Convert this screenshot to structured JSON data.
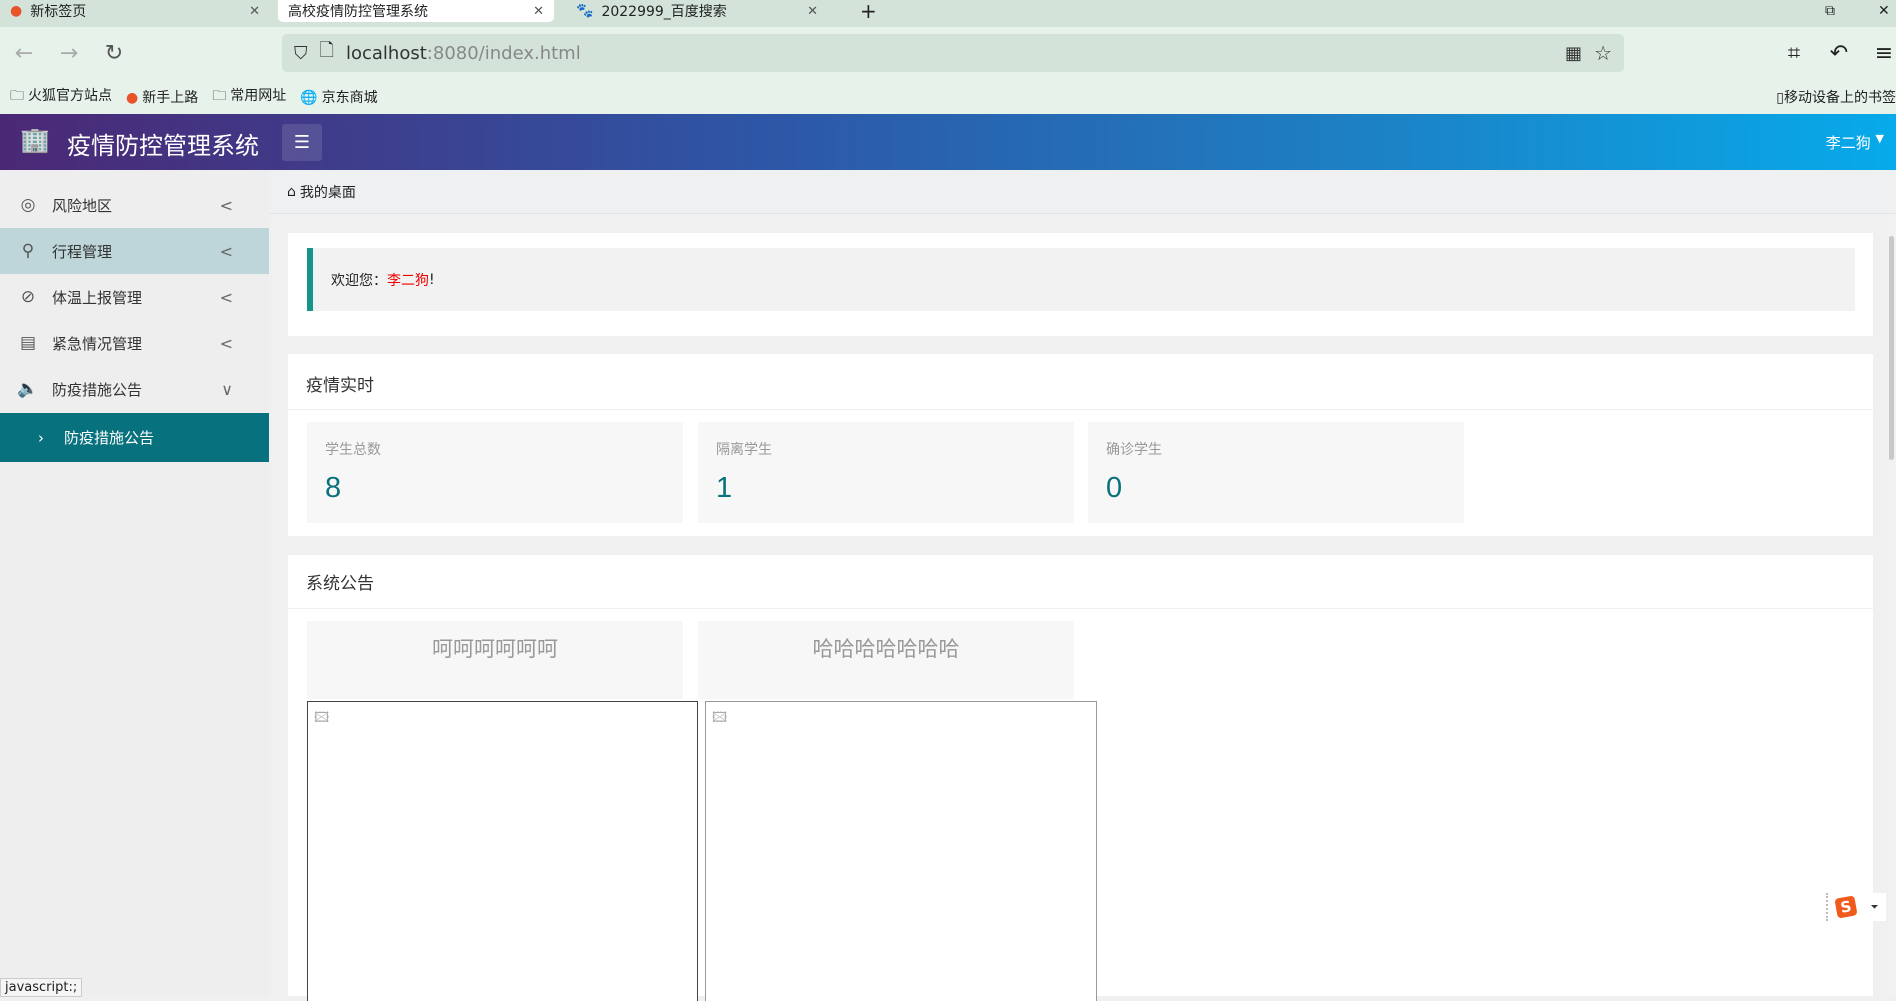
{
  "browser": {
    "tabs": [
      {
        "label": "新标签页"
      },
      {
        "label": "高校疫情防控管理系统"
      },
      {
        "label": "2022999_百度搜索"
      }
    ],
    "url_host": "localhost",
    "url_rest": ":8080/index.html",
    "bookmarks": [
      "火狐官方站点",
      "新手上路",
      "常用网址",
      "京东商城"
    ],
    "mobile_bookmarks": "移动设备上的书签",
    "status": "javascript:;"
  },
  "header": {
    "title": "疫情防控管理系统",
    "user": "李二狗"
  },
  "sidebar": {
    "items": [
      {
        "label": "风险地区"
      },
      {
        "label": "行程管理"
      },
      {
        "label": "体温上报管理"
      },
      {
        "label": "紧急情况管理"
      },
      {
        "label": "防疫措施公告"
      }
    ],
    "sub_item": "防疫措施公告"
  },
  "breadcrumb": "我的桌面",
  "welcome": {
    "prefix": "欢迎您：",
    "name": "李二狗",
    "suffix": "!"
  },
  "stats": {
    "title": "疫情实时",
    "items": [
      {
        "label": "学生总数",
        "value": "8"
      },
      {
        "label": "隔离学生",
        "value": "1"
      },
      {
        "label": "确诊学生",
        "value": "0"
      }
    ]
  },
  "notices": {
    "title": "系统公告",
    "items": [
      {
        "title": "呵呵呵呵呵呵"
      },
      {
        "title": "哈哈哈哈哈哈哈"
      }
    ]
  },
  "colors": {
    "accent": "#08717e",
    "quote_bar": "#16968a",
    "name": "#ee0000"
  }
}
